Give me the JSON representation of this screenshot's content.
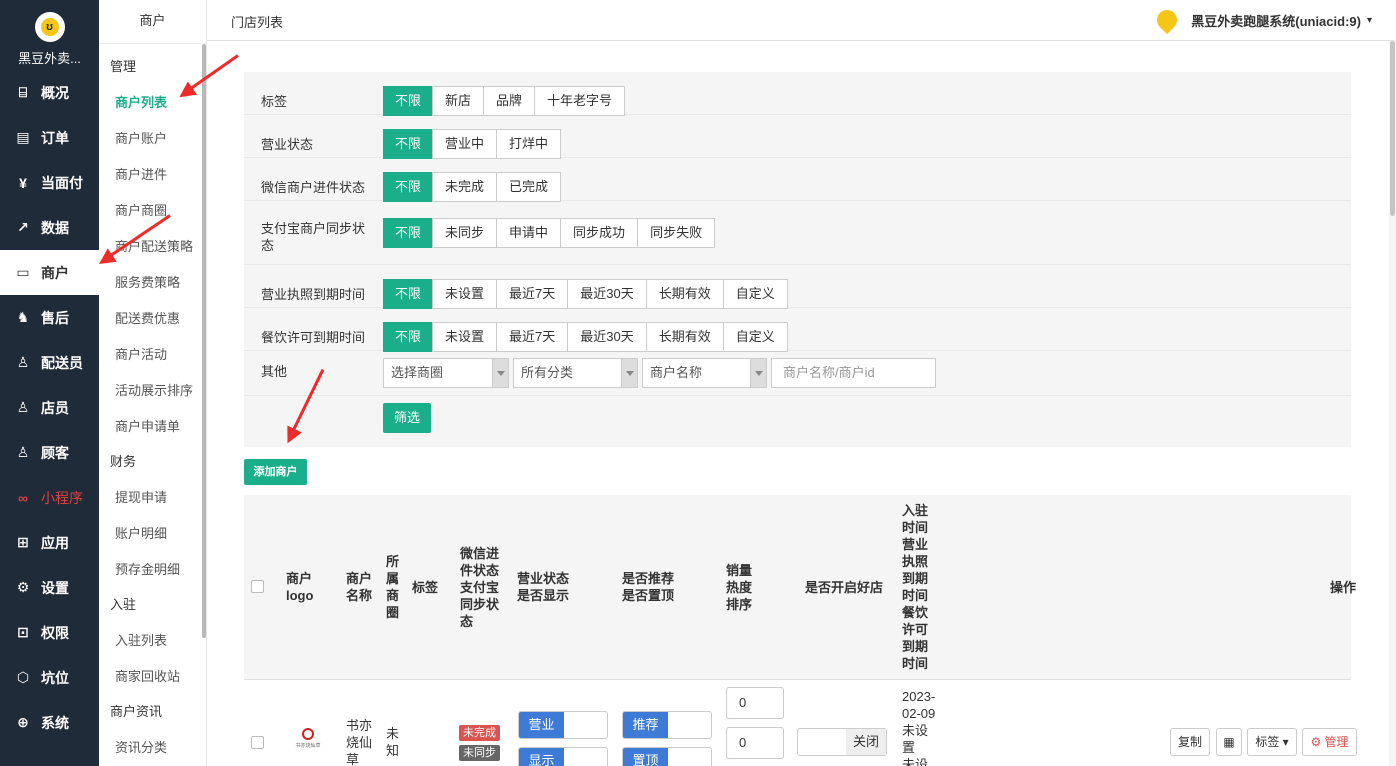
{
  "app": {
    "name": "黑豆外卖...",
    "system_label": "黑豆外卖跑腿系统(uniacid:9)",
    "logo_glyph": "ʊ"
  },
  "nav": [
    {
      "label": "概况",
      "icon": "overview-icon",
      "glyph": "⌸"
    },
    {
      "label": "订单",
      "icon": "order-icon",
      "glyph": "▤"
    },
    {
      "label": "当面付",
      "icon": "yen-icon",
      "glyph": "¥"
    },
    {
      "label": "数据",
      "icon": "chart-icon",
      "glyph": "↗"
    },
    {
      "label": "商户",
      "icon": "store-icon",
      "glyph": "▭"
    },
    {
      "label": "售后",
      "icon": "headset-icon",
      "glyph": "♞"
    },
    {
      "label": "配送员",
      "icon": "courier-icon",
      "glyph": "♙"
    },
    {
      "label": "店员",
      "icon": "clerk-icon",
      "glyph": "♙"
    },
    {
      "label": "顾客",
      "icon": "customer-icon",
      "glyph": "♙"
    },
    {
      "label": "小程序",
      "icon": "miniprogram-icon",
      "glyph": "∞"
    },
    {
      "label": "应用",
      "icon": "apps-icon",
      "glyph": "⊞"
    },
    {
      "label": "设置",
      "icon": "gear-icon",
      "glyph": "⚙"
    },
    {
      "label": "权限",
      "icon": "lock-icon",
      "glyph": "⊡"
    },
    {
      "label": "坑位",
      "icon": "cube-icon",
      "glyph": "⬡"
    },
    {
      "label": "系统",
      "icon": "system-icon",
      "glyph": "⊕"
    }
  ],
  "sub": {
    "title": "商户",
    "groups": [
      "管理",
      "财务",
      "入驻",
      "商户资讯"
    ],
    "items": [
      "商户列表",
      "商户账户",
      "商户进件",
      "商户商圈",
      "商户配送策略",
      "服务费策略",
      "配送费优惠",
      "商户活动",
      "活动展示排序",
      "商户申请单",
      "提现申请",
      "账户明细",
      "预存金明细",
      "入驻列表",
      "商家回收站",
      "资讯分类"
    ]
  },
  "breadcrumb": "门店列表",
  "filters": [
    {
      "label": "标签",
      "options": [
        "不限",
        "新店",
        "品牌",
        "十年老字号"
      ]
    },
    {
      "label": "营业状态",
      "options": [
        "不限",
        "营业中",
        "打烊中"
      ]
    },
    {
      "label": "微信商户进件状态",
      "options": [
        "不限",
        "未完成",
        "已完成"
      ]
    },
    {
      "label": "支付宝商户同步状态",
      "options": [
        "不限",
        "未同步",
        "申请中",
        "同步成功",
        "同步失败"
      ]
    },
    {
      "label": "营业执照到期时间",
      "options": [
        "不限",
        "未设置",
        "最近7天",
        "最近30天",
        "长期有效",
        "自定义"
      ]
    },
    {
      "label": "餐饮许可到期时间",
      "options": [
        "不限",
        "未设置",
        "最近7天",
        "最近30天",
        "长期有效",
        "自定义"
      ]
    }
  ],
  "other": {
    "label": "其他",
    "select1": "选择商圈",
    "select2": "所有分类",
    "select3": "商户名称",
    "input_placeholder": "商户名称/商户id",
    "filter_btn": "筛选"
  },
  "add_btn": "添加商户",
  "table": {
    "headers": [
      "商户\nlogo",
      "商户\n名称",
      "所\n属\n商\n圈",
      "标签",
      "微信进\n件状态\n支付宝\n同步状\n态",
      "营业状态\n是否显示",
      "是否推荐\n是否置顶",
      "销量\n热度\n排序",
      "是否开启好店",
      "入驻\n时间\n营业\n执照\n到期\n时间\n餐饮\n许可\n到期\n时间",
      "操作"
    ],
    "row": {
      "logo_text": "书亦烧仙草",
      "name": "书亦\n烧仙\n草",
      "area": "未\n知",
      "wx_status": "未完成",
      "ali_status": "未同步",
      "open": "营业",
      "show": "显示",
      "recommend": "推荐",
      "top": "置顶",
      "sales": "0",
      "heat": "0",
      "good_store_off": "关闭",
      "dates": "2023-\n02-09\n未设\n置\n未设",
      "ops": [
        "复制",
        "标签",
        "管理"
      ]
    }
  }
}
